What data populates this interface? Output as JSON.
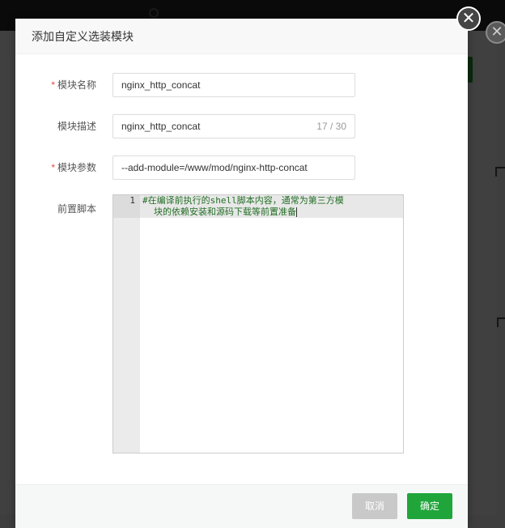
{
  "dialog": {
    "title": "添加自定义选装模块",
    "close_symbol": "✕"
  },
  "form": {
    "name": {
      "label": "模块名称",
      "required_mark": "*",
      "value": "nginx_http_concat"
    },
    "description": {
      "label": "模块描述",
      "value": "nginx_http_concat",
      "counter": "17 / 30"
    },
    "params": {
      "label": "模块参数",
      "required_mark": "*",
      "value": "--add-module=/www/mod/nginx-http-concat"
    },
    "script": {
      "label": "前置脚本",
      "line_number": "1",
      "code_line_1": "#在编译前执行的shell脚本内容，通常为第三方模",
      "code_line_2": "块的依赖安装和源码下载等前置准备"
    }
  },
  "footer": {
    "cancel_label": "取消",
    "confirm_label": "确定"
  },
  "background": {
    "close_symbol": "✕"
  },
  "colors": {
    "accent": "#20a53a",
    "required": "#ef4444",
    "code_comment": "#236e25",
    "cancel_bg": "#c9c9c9"
  },
  "icons": {
    "close": "close-icon"
  }
}
